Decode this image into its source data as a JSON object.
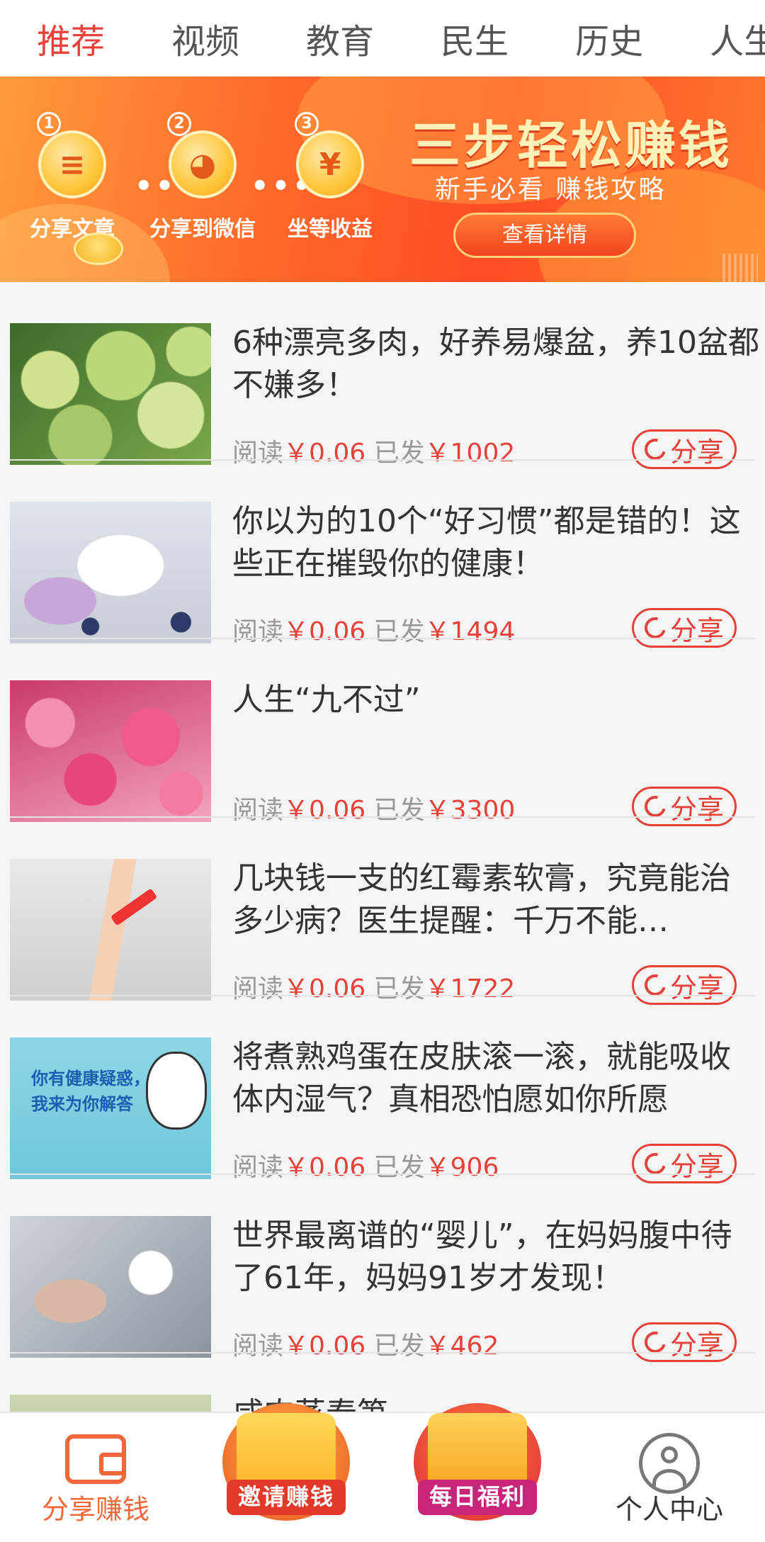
{
  "tabs": [
    "推荐",
    "视频",
    "教育",
    "民生",
    "历史",
    "人生"
  ],
  "banner": {
    "steps": [
      {
        "num": "1",
        "icon": "document-icon",
        "glyph": "≡",
        "label": "分享文章"
      },
      {
        "num": "2",
        "icon": "wechat-icon",
        "glyph": "◕",
        "label": "分享到微信"
      },
      {
        "num": "3",
        "icon": "yuan-coin-icon",
        "glyph": "¥",
        "label": "坐等收益"
      }
    ],
    "dots": "•••",
    "title": "三步轻松赚钱",
    "subtitle": "新手必看 赚钱攻略",
    "button": "查看详情"
  },
  "articles": [
    {
      "title": "6种漂亮多肉，好养易爆盆，养10盆都不嫌多！",
      "read_label": "阅读",
      "read_value": "￥0.06",
      "sent_label": "已发",
      "sent_value": "￥1002",
      "share": "分享"
    },
    {
      "title": "你以为的10个“好习惯”都是错的！这些正在摧毁你的健康！",
      "read_label": "阅读",
      "read_value": "￥0.06",
      "sent_label": "已发",
      "sent_value": "￥1494",
      "share": "分享"
    },
    {
      "title": "人生“九不过”",
      "read_label": "阅读",
      "read_value": "￥0.06",
      "sent_label": "已发",
      "sent_value": "￥3300",
      "share": "分享"
    },
    {
      "title": "几块钱一支的红霉素软膏，究竟能治多少病？医生提醒：千万不能…",
      "read_label": "阅读",
      "read_value": "￥0.06",
      "sent_label": "已发",
      "sent_value": "￥1722",
      "share": "分享"
    },
    {
      "title": "将煮熟鸡蛋在皮肤滚一滚，就能吸收体内湿气？真相恐怕愿如你所愿",
      "read_label": "阅读",
      "read_value": "￥0.06",
      "sent_label": "已发",
      "sent_value": "￥906",
      "share": "分享"
    },
    {
      "title": "世界最离谱的“婴儿”，在妈妈腹中待了61年，妈妈91岁才发现！",
      "read_label": "阅读",
      "read_value": "￥0.06",
      "sent_label": "已发",
      "sent_value": "￥462",
      "share": "分享"
    },
    {
      "title": "咸肉蒸春笋"
    }
  ],
  "thumb_texts": {
    "t5": "你有健康疑惑，\n我来为你解答"
  },
  "nav": [
    {
      "label": "分享赚钱",
      "icon": "wallet-icon",
      "active": true
    },
    {
      "label": "邀请赚钱",
      "icon": "invite-badge-icon"
    },
    {
      "label": "每日福利",
      "icon": "gift-badge-icon"
    },
    {
      "label": "个人中心",
      "icon": "user-icon"
    }
  ],
  "colors": {
    "accent": "#e8413a",
    "nav_active": "#f0673a",
    "banner_orange": "#ff6a2a"
  }
}
